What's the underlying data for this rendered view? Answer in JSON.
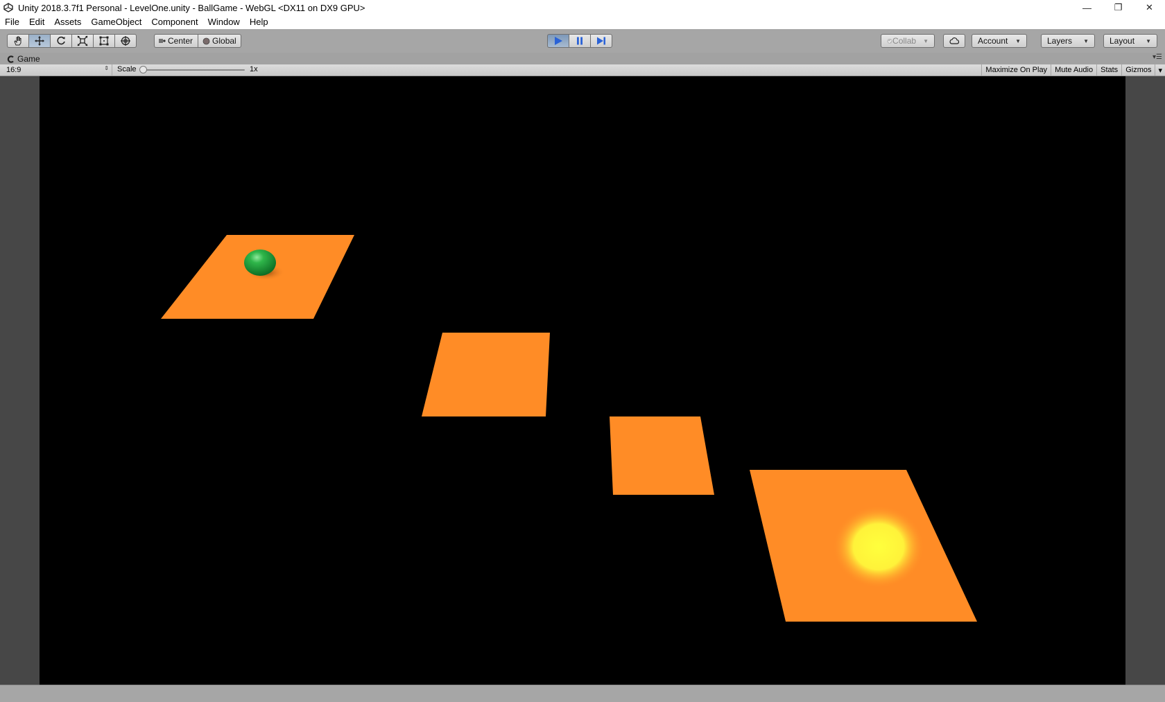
{
  "window": {
    "title": "Unity 2018.3.7f1 Personal - LevelOne.unity - BallGame - WebGL <DX11 on DX9 GPU>",
    "minimize_glyph": "—",
    "maximize_glyph": "❐",
    "close_glyph": "✕"
  },
  "menubar": {
    "items": [
      "File",
      "Edit",
      "Assets",
      "GameObject",
      "Component",
      "Window",
      "Help"
    ]
  },
  "toolbar": {
    "tools": [
      {
        "name": "hand-tool",
        "icon": "hand-icon"
      },
      {
        "name": "move-tool",
        "icon": "move-icon",
        "active": true
      },
      {
        "name": "rotate-tool",
        "icon": "rotate-icon"
      },
      {
        "name": "scale-tool",
        "icon": "scale-icon"
      },
      {
        "name": "rect-tool",
        "icon": "rect-icon"
      },
      {
        "name": "transform-tool",
        "icon": "transform-icon"
      }
    ],
    "pivot_label": "Center",
    "space_label": "Global",
    "collab_label": "Collab",
    "account_label": "Account",
    "layers_label": "Layers",
    "layout_label": "Layout",
    "play_state": {
      "playing": true,
      "paused": false
    }
  },
  "game_tab": {
    "label": "Game"
  },
  "game_view": {
    "aspect": "16:9",
    "scale_label": "Scale",
    "scale_value": "1x",
    "toggles": [
      "Maximize On Play",
      "Mute Audio",
      "Stats",
      "Gizmos"
    ]
  },
  "scene": {
    "background_color": "#000000",
    "platform_color": "#ff8c26",
    "ball_color": "#2fb64a",
    "goal_light_color": "#ffff3c"
  }
}
